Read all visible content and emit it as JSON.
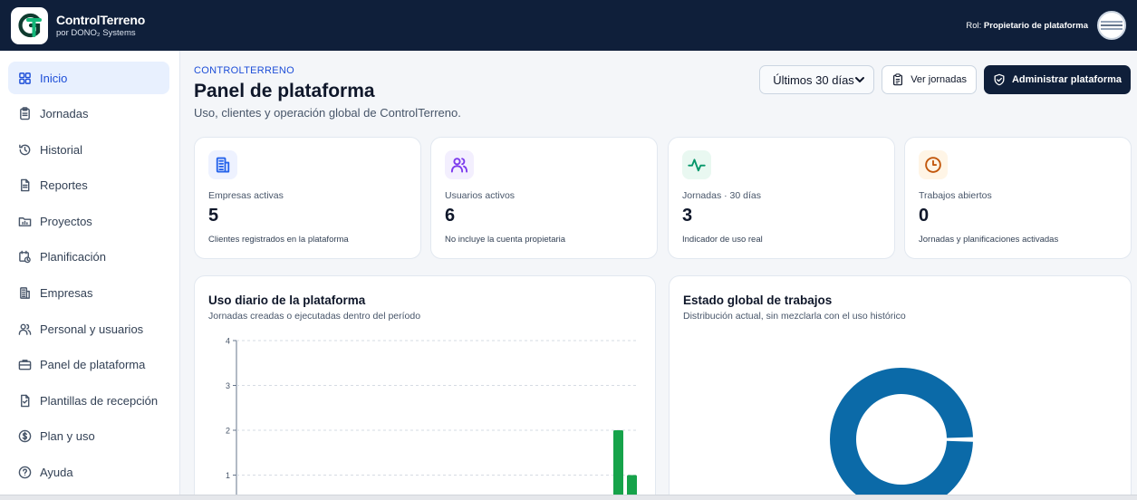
{
  "brand": {
    "name": "ControlTerreno",
    "sub": "por DONO₂ Systems"
  },
  "user": {
    "role_prefix": "Rol: ",
    "role": "Propietario de plataforma"
  },
  "sidebar": {
    "items": [
      {
        "label": "Inicio",
        "icon": "dashboard-icon",
        "active": true
      },
      {
        "label": "Jornadas",
        "icon": "clipboard-icon"
      },
      {
        "label": "Historial",
        "icon": "history-icon"
      },
      {
        "label": "Reportes",
        "icon": "document-icon"
      },
      {
        "label": "Proyectos",
        "icon": "folder-icon"
      },
      {
        "label": "Planificación",
        "icon": "calendar-clock-icon"
      },
      {
        "label": "Empresas",
        "icon": "building-icon"
      },
      {
        "label": "Personal y usuarios",
        "icon": "users-icon"
      },
      {
        "label": "Panel de plataforma",
        "icon": "briefcase-icon"
      },
      {
        "label": "Plantillas de recepción",
        "icon": "file-template-icon"
      },
      {
        "label": "Plan y uso",
        "icon": "dollar-circle-icon"
      },
      {
        "label": "Ayuda",
        "icon": "help-circle-icon"
      }
    ]
  },
  "header": {
    "eyebrow": "CONTROLTERRENO",
    "title": "Panel de plataforma",
    "subtitle": "Uso, clientes y operación global de ControlTerreno."
  },
  "actions": {
    "period": "Últimos 30 días",
    "view_label": "Ver jornadas",
    "admin_label": "Administrar plataforma"
  },
  "stats": [
    {
      "label": "Empresas activas",
      "value": "5",
      "note": "Clientes registrados en la plataforma",
      "icon": "building-icon",
      "color": "#2563eb",
      "bg": "#eef2ff"
    },
    {
      "label": "Usuarios activos",
      "value": "6",
      "note": "No incluye la cuenta propietaria",
      "icon": "users-icon",
      "color": "#7c3aed",
      "bg": "#f3effe"
    },
    {
      "label": "Jornadas · 30 días",
      "value": "3",
      "note": "Indicador de uso real",
      "icon": "activity-icon",
      "color": "#059669",
      "bg": "#e9f8f1"
    },
    {
      "label": "Trabajos abiertos",
      "value": "0",
      "note": "Jornadas y planificaciones activadas",
      "icon": "clock-icon",
      "color": "#c2570c",
      "bg": "#fff5e6"
    }
  ],
  "usage_panel": {
    "title": "Uso diario de la plataforma",
    "subtitle": "Jornadas creadas o ejecutadas dentro del período"
  },
  "status_panel": {
    "title": "Estado global de trabajos",
    "subtitle": "Distribución actual, sin mezclarla con el uso histórico"
  },
  "chart_data": [
    {
      "type": "bar",
      "yticks": [
        "4",
        "3",
        "2",
        "1"
      ],
      "ylim": [
        0,
        4
      ],
      "grid": true,
      "series": [
        {
          "values": [
            2,
            1
          ]
        }
      ],
      "color": "#16a34a"
    },
    {
      "type": "pie",
      "donut": true,
      "values": [
        1
      ],
      "color": "#0b6aa8"
    }
  ]
}
